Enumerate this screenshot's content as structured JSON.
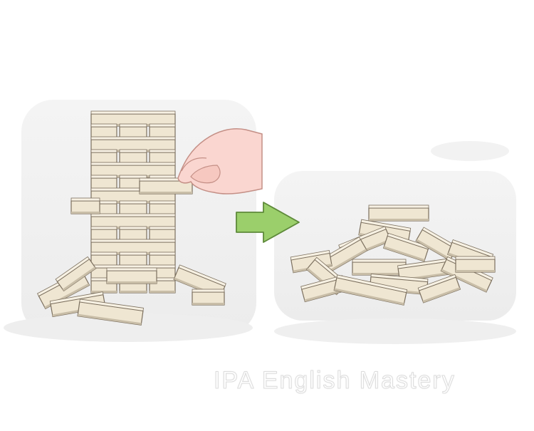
{
  "illustration": {
    "left_panel": "jenga-tower-block-pull",
    "arrow": "arrow-right-icon",
    "right_panel": "collapsed-block-pile"
  },
  "colors": {
    "block_face": "#efe6d2",
    "block_top": "#f7f1e3",
    "block_shadow": "#c9bea8",
    "outline": "#7b6f5e",
    "hand": "#fad6d0",
    "hand_outline": "#c48f86",
    "arrow": "#9bcf6b",
    "arrow_outline": "#5e8a3a",
    "panel": "#f1f1f1"
  },
  "watermark": {
    "text": "IPA English Mastery"
  }
}
